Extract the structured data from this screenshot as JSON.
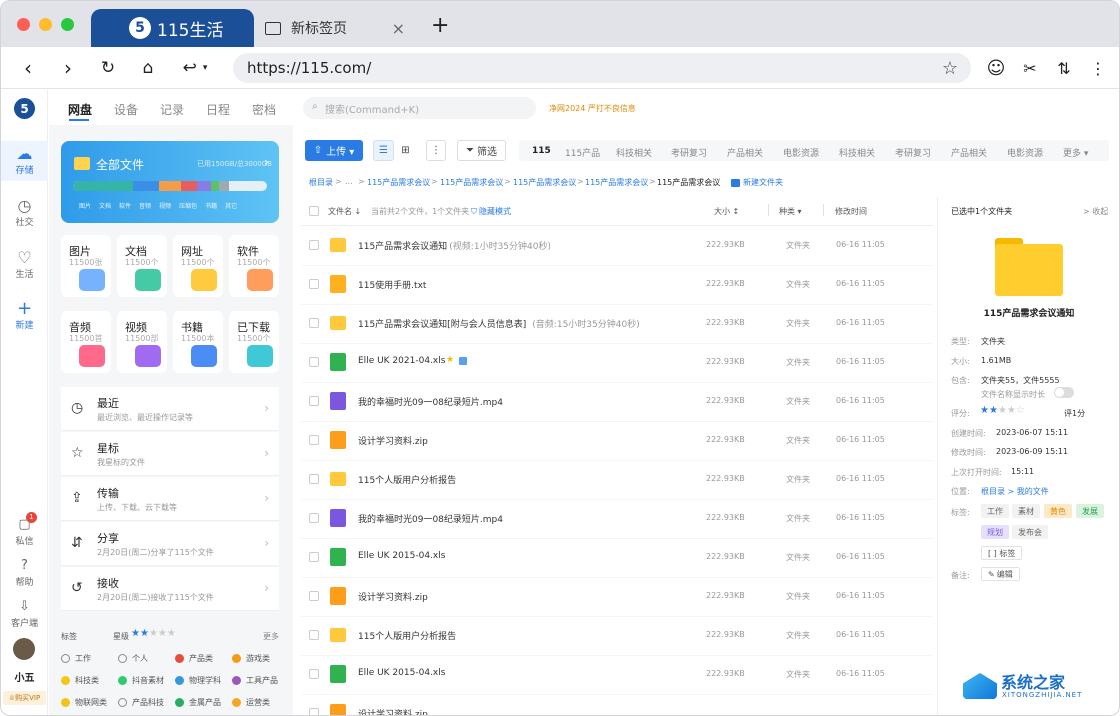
{
  "browser": {
    "tab_active": {
      "logo": "5",
      "title": "115生活"
    },
    "tab_new": {
      "title": "新标签页",
      "close": "×"
    },
    "new_tab": "+",
    "url": "https://115.com/"
  },
  "rail": {
    "logo": "5",
    "items": [
      {
        "label": "存储",
        "icon": "cloud-icon"
      },
      {
        "label": "社交",
        "icon": "clock-icon"
      },
      {
        "label": "生活",
        "icon": "heart-icon"
      },
      {
        "label": "新建",
        "icon": "plus-icon"
      }
    ],
    "bottom": [
      {
        "label": "私信",
        "badge": "1"
      },
      {
        "label": "帮助"
      },
      {
        "label": "客户端"
      }
    ],
    "user": "小五",
    "vip": "购买VIP"
  },
  "topnav": {
    "items": [
      "网盘",
      "设备",
      "记录",
      "日程",
      "密档"
    ],
    "search_placeholder": "搜索(Command+K)",
    "notice": "净网2024 严打不良信息"
  },
  "left": {
    "all_files": {
      "title": "全部文件",
      "usage": "已用150GB/总3000GB",
      "legend": [
        "图片",
        "文档",
        "软件",
        "音频",
        "视频",
        "压缩包",
        "书籍",
        "其它"
      ]
    },
    "categories": [
      {
        "name": "图片",
        "count": "11500张"
      },
      {
        "name": "文档",
        "count": "11500个"
      },
      {
        "name": "网址",
        "count": "11500个"
      },
      {
        "name": "软件",
        "count": "11500个"
      },
      {
        "name": "音频",
        "count": "11500首"
      },
      {
        "name": "视频",
        "count": "11500部"
      },
      {
        "name": "书籍",
        "count": "11500本"
      },
      {
        "name": "已下载",
        "count": "11500个"
      }
    ],
    "rows": [
      {
        "title": "最近",
        "sub": "最近浏览、最近操作记录等"
      },
      {
        "title": "星标",
        "sub": "我星标的文件"
      },
      {
        "title": "传输",
        "sub": "上传、下载、云下载等"
      },
      {
        "title": "分享",
        "sub": "2月20日(周二)分享了115个文件"
      },
      {
        "title": "接收",
        "sub": "2月20日(周二)接收了115个文件"
      }
    ],
    "tags_label": "标签",
    "stars_label": "星级",
    "more": "更多",
    "tags": [
      {
        "name": "工作",
        "color": "#ffffff"
      },
      {
        "name": "个人",
        "color": "#ffffff"
      },
      {
        "name": "产品类",
        "color": "#e74c3c"
      },
      {
        "name": "游戏类",
        "color": "#f39c12"
      },
      {
        "name": "科技类",
        "color": "#f5c518"
      },
      {
        "name": "抖音素材",
        "color": "#2ecc71"
      },
      {
        "name": "物理学科",
        "color": "#3498db"
      },
      {
        "name": "工具产品",
        "color": "#9b59b6"
      },
      {
        "name": "物联网类",
        "color": "#f0c419"
      },
      {
        "name": "产品科技",
        "color": "#ffffff"
      },
      {
        "name": "金属产品",
        "color": "#27ae60"
      },
      {
        "name": "运营类",
        "color": "#f5a623"
      }
    ]
  },
  "toolbar": {
    "upload": "上传 ▾",
    "filter": "筛选",
    "quick_tabs": [
      "115",
      "115产品",
      "科技相关",
      "考研复习",
      "产品相关",
      "电影资源",
      "科技相关",
      "考研复习",
      "产品相关",
      "电影资源",
      "更多 ▾"
    ]
  },
  "breadcrumb": {
    "items": [
      "根目录",
      ">",
      "...",
      ">",
      "115产品需求会议",
      ">",
      "115产品需求会议",
      ">",
      "115产品需求会议",
      ">",
      "115产品需求会议",
      ">",
      "115产品需求会议"
    ],
    "new_folder": "新建文件夹"
  },
  "table": {
    "headers": {
      "name": "文件名 ↓",
      "summary": "当前共2个文件，1个文件夹",
      "hide": "隐藏模式",
      "size": "大小 ↕",
      "type": "种类 ▾",
      "mtime": "修改时间"
    },
    "rows": [
      {
        "kind": "folder",
        "name": "115产品需求会议通知",
        "extra": " (视频:1小时35分钟40秒)",
        "size": "222.93KB",
        "type": "文件夹",
        "time": "06-16 11:05"
      },
      {
        "kind": "txt",
        "name": "115使用手册.txt",
        "extra": "",
        "size": "222.93KB",
        "type": "文件夹",
        "time": "06-16 11:05"
      },
      {
        "kind": "folder",
        "name": "115产品需求会议通知[附与会人员信息表]",
        "extra": " (音频:15小时35分钟40秒)",
        "size": "222.93KB",
        "type": "文件夹",
        "time": "06-16 11:05"
      },
      {
        "kind": "xls",
        "name": "Elle UK 2021-04.xls",
        "extra": "",
        "size": "222.93KB",
        "type": "文件夹",
        "time": "06-16 11:05"
      },
      {
        "kind": "video",
        "name": "我的幸福时光09一08纪录短片.mp4",
        "extra": "",
        "size": "222.93KB",
        "type": "文件夹",
        "time": "06-16 11:05"
      },
      {
        "kind": "zip",
        "name": "设计学习资料.zip",
        "extra": "",
        "size": "222.93KB",
        "type": "文件夹",
        "time": "06-16 11:05"
      },
      {
        "kind": "folder",
        "name": "115个人版用户分析报告",
        "extra": "",
        "size": "222.93KB",
        "type": "文件夹",
        "time": "06-16 11:05"
      },
      {
        "kind": "video",
        "name": "我的幸福时光09一08纪录短片.mp4",
        "extra": "",
        "size": "222.93KB",
        "type": "文件夹",
        "time": "06-16 11:05"
      },
      {
        "kind": "xls",
        "name": "Elle UK 2015-04.xls",
        "extra": "",
        "size": "222.93KB",
        "type": "文件夹",
        "time": "06-16 11:05"
      },
      {
        "kind": "zip",
        "name": "设计学习资料.zip",
        "extra": "",
        "size": "222.93KB",
        "type": "文件夹",
        "time": "06-16 11:05"
      },
      {
        "kind": "folder",
        "name": "115个人版用户分析报告",
        "extra": "",
        "size": "222.93KB",
        "type": "文件夹",
        "time": "06-16 11:05"
      },
      {
        "kind": "xls",
        "name": "Elle UK 2015-04.xls",
        "extra": "",
        "size": "222.93KB",
        "type": "文件夹",
        "time": "06-16 11:05"
      },
      {
        "kind": "zip",
        "name": "设计学习资料.zip",
        "extra": "",
        "size": "",
        "type": "",
        "time": ""
      }
    ]
  },
  "detail": {
    "title": "已选中1个文件夹",
    "collapse": "> 收起",
    "name": "115产品需求会议通知",
    "type_l": "类型:",
    "type_v": "文件夹",
    "size_l": "大小:",
    "size_v": "1.61MB",
    "contains_l": "包含:",
    "contains_v": "文件夹55，文件5555",
    "showlen_l": "文件名称显示时长",
    "rating_l": "评分:",
    "rating_v": "评1分",
    "ctime_l": "创建时间:",
    "ctime_v": "2023-06-07 15:11",
    "mtime_l": "修改时间:",
    "mtime_v": "2023-06-09 15:11",
    "otime_l": "上次打开时间:",
    "otime_v": "15:11",
    "loc_l": "位置:",
    "loc_v": "根目录 > 我的文件",
    "tags_l": "标签:",
    "tags": [
      {
        "name": "工作",
        "bg": "#f2f2f2",
        "fg": "#666"
      },
      {
        "name": "素材",
        "bg": "#f2f2f2",
        "fg": "#666"
      },
      {
        "name": "黄色",
        "bg": "#fde9c8",
        "fg": "#e08a00"
      },
      {
        "name": "发展",
        "bg": "#d9f3de",
        "fg": "#2e9e4f"
      },
      {
        "name": "规划",
        "bg": "#e6e0fa",
        "fg": "#7b5ce0"
      },
      {
        "name": "发布会",
        "bg": "#f2f2f2",
        "fg": "#666"
      }
    ],
    "tag_btn": "[ ] 标签",
    "note_l": "备注:",
    "note_btn": "编辑"
  },
  "watermark": {
    "cn": "系统之家",
    "en": "XITONGZHIJIA.NET"
  }
}
